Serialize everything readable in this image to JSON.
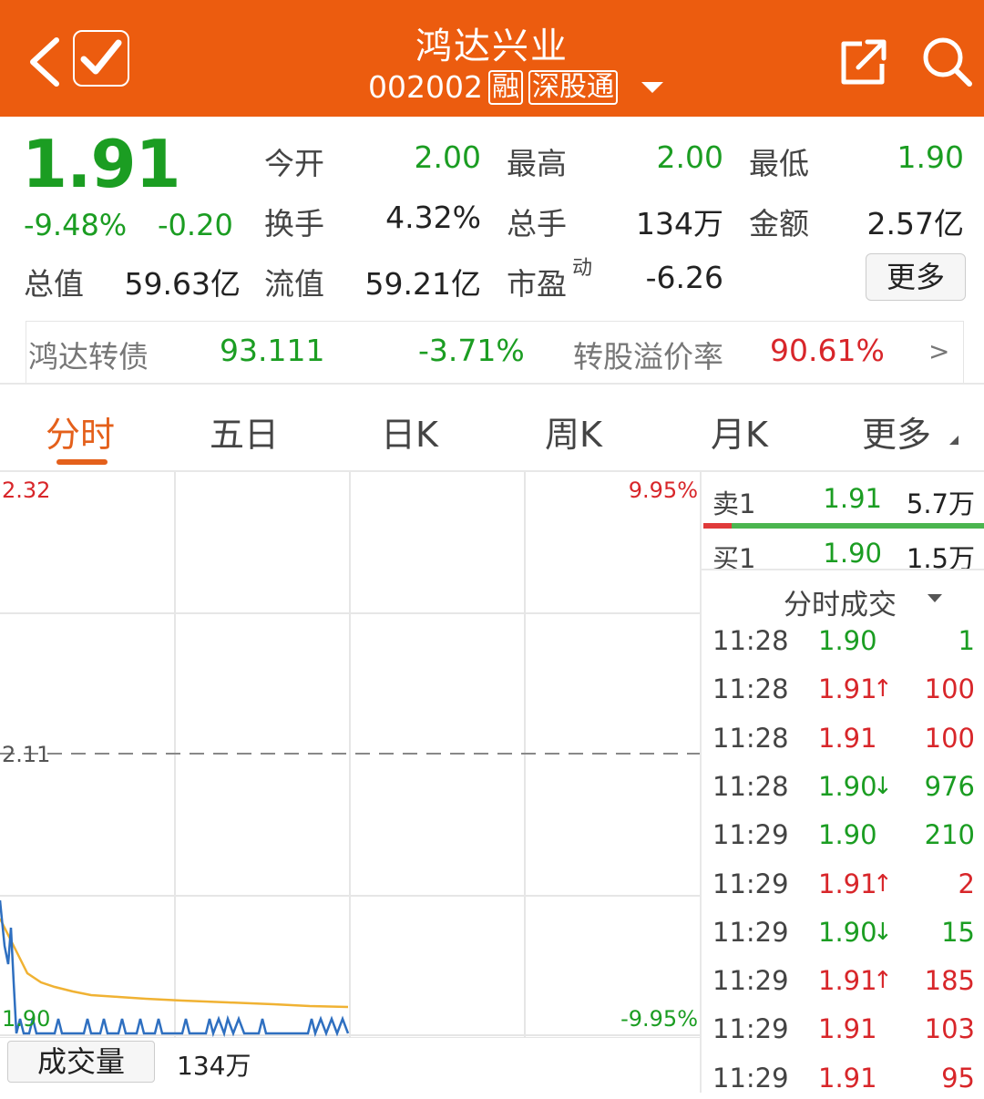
{
  "header": {
    "title": "鸿达兴业",
    "code": "002002",
    "tags": [
      "融",
      "深股通"
    ],
    "colors": {
      "bar": "#ec5c0f"
    },
    "icons": [
      "back-icon",
      "checkbox-icon",
      "share-icon",
      "search-icon"
    ]
  },
  "quote": {
    "price": "1.91",
    "change_pct": "-9.48%",
    "change": "-0.20",
    "open_label": "今开",
    "open": "2.00",
    "high_label": "最高",
    "high": "2.00",
    "low_label": "最低",
    "low": "1.90",
    "turnover_label": "换手",
    "turnover": "4.32%",
    "volume_label": "总手",
    "volume": "134万",
    "amount_label": "金额",
    "amount": "2.57亿",
    "mktcap_label": "总值",
    "mktcap": "59.63亿",
    "float_label": "流值",
    "float": "59.21亿",
    "pe_label": "市盈",
    "pe_sup": "动",
    "pe": "-6.26",
    "more_label": "更多"
  },
  "bond": {
    "name": "鸿达转债",
    "price": "93.111",
    "change_pct": "-3.71%",
    "premium_label": "转股溢价率",
    "premium": "90.61%",
    "arrow": ">"
  },
  "tabs": [
    {
      "label": "分时",
      "active": true
    },
    {
      "label": "五日"
    },
    {
      "label": "日K"
    },
    {
      "label": "周K"
    },
    {
      "label": "月K"
    },
    {
      "label": "更多"
    }
  ],
  "chart": {
    "top_price": "2.32",
    "mid_price": "2.11",
    "bottom_price": "1.90",
    "top_pct": "9.95%",
    "bottom_pct": "-9.95%",
    "volume_label": "成交量",
    "volume_value": "134万"
  },
  "orderbook": {
    "sell_label": "卖1",
    "sell_price": "1.91",
    "sell_qty": "5.7万",
    "buy_label": "买1",
    "buy_price": "1.90",
    "buy_qty": "1.5万",
    "sell_ratio": 0.1
  },
  "trades_title": "分时成交",
  "trades": [
    {
      "time": "11:28",
      "price": "1.90",
      "dir": "",
      "qty": "1",
      "color": "green"
    },
    {
      "time": "11:28",
      "price": "1.91",
      "dir": "↑",
      "qty": "100",
      "color": "red"
    },
    {
      "time": "11:28",
      "price": "1.91",
      "dir": "",
      "qty": "100",
      "color": "red"
    },
    {
      "time": "11:28",
      "price": "1.90",
      "dir": "↓",
      "qty": "976",
      "color": "green"
    },
    {
      "time": "11:29",
      "price": "1.90",
      "dir": "",
      "qty": "210",
      "color": "green"
    },
    {
      "time": "11:29",
      "price": "1.91",
      "dir": "↑",
      "qty": "2",
      "color": "red"
    },
    {
      "time": "11:29",
      "price": "1.90",
      "dir": "↓",
      "qty": "15",
      "color": "green"
    },
    {
      "time": "11:29",
      "price": "1.91",
      "dir": "↑",
      "qty": "185",
      "color": "red"
    },
    {
      "time": "11:29",
      "price": "1.91",
      "dir": "",
      "qty": "103",
      "color": "red"
    },
    {
      "time": "11:29",
      "price": "1.91",
      "dir": "",
      "qty": "95",
      "color": "red"
    }
  ]
}
